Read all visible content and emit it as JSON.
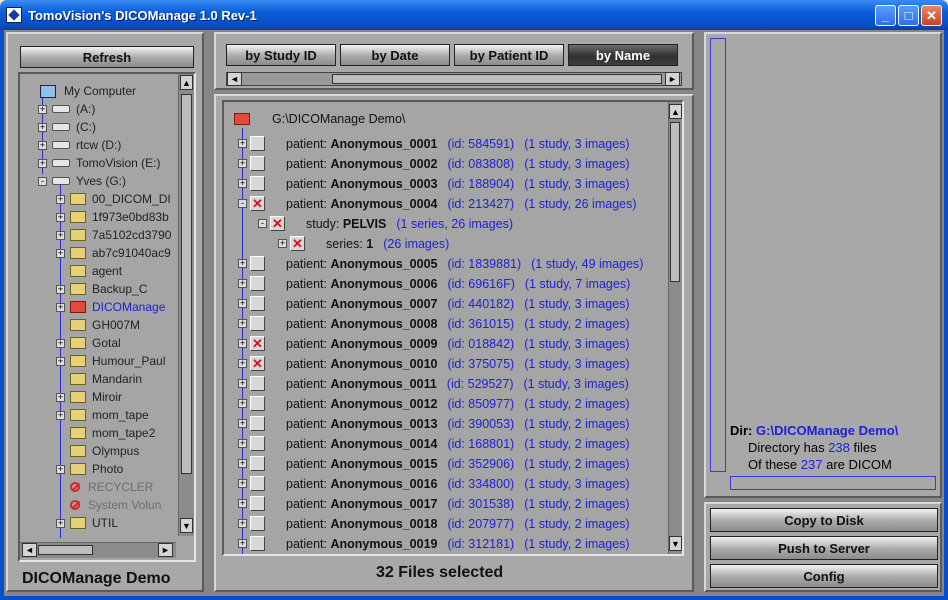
{
  "window": {
    "title": "TomoVision's  DICOManage 1.0 Rev-1",
    "controls": {
      "minimize": "_",
      "maximize": "□",
      "close": "✕"
    }
  },
  "left": {
    "refresh_label": "Refresh",
    "tree": [
      {
        "label": "My Computer",
        "icon": "computer-icon",
        "level": 0,
        "expand": ""
      },
      {
        "label": "(A:)",
        "icon": "floppy-drive-icon",
        "level": 1,
        "expand": "+"
      },
      {
        "label": "(C:)",
        "icon": "drive-icon",
        "level": 1,
        "expand": "+"
      },
      {
        "label": "rtcw (D:)",
        "icon": "cd-drive-icon",
        "level": 1,
        "expand": "+"
      },
      {
        "label": "TomoVision (E:)",
        "icon": "drive-icon",
        "level": 1,
        "expand": "+"
      },
      {
        "label": "Yves (G:)",
        "icon": "drive-icon",
        "level": 1,
        "expand": "-"
      },
      {
        "label": "00_DICOM_DI",
        "icon": "folder-icon",
        "level": 2,
        "expand": "+"
      },
      {
        "label": "1f973e0bd83b",
        "icon": "folder-icon",
        "level": 2,
        "expand": "+"
      },
      {
        "label": "7a5102cd3790",
        "icon": "folder-icon",
        "level": 2,
        "expand": "+"
      },
      {
        "label": "ab7c91040ac9",
        "icon": "folder-icon",
        "level": 2,
        "expand": "+"
      },
      {
        "label": "agent",
        "icon": "folder-icon",
        "level": 2,
        "expand": ""
      },
      {
        "label": "Backup_C",
        "icon": "folder-icon",
        "level": 2,
        "expand": "+"
      },
      {
        "label": "DICOManage",
        "icon": "open-folder-icon",
        "level": 2,
        "expand": "+",
        "selected": true
      },
      {
        "label": "GH007M",
        "icon": "folder-icon",
        "level": 2,
        "expand": ""
      },
      {
        "label": "Gotal",
        "icon": "folder-icon",
        "level": 2,
        "expand": "+"
      },
      {
        "label": "Humour_Paul",
        "icon": "folder-icon",
        "level": 2,
        "expand": "+"
      },
      {
        "label": "Mandarin",
        "icon": "folder-icon",
        "level": 2,
        "expand": ""
      },
      {
        "label": "Miroir",
        "icon": "folder-icon",
        "level": 2,
        "expand": "+"
      },
      {
        "label": "mom_tape",
        "icon": "folder-icon",
        "level": 2,
        "expand": "+"
      },
      {
        "label": "mom_tape2",
        "icon": "folder-icon",
        "level": 2,
        "expand": ""
      },
      {
        "label": "Olympus",
        "icon": "folder-icon",
        "level": 2,
        "expand": ""
      },
      {
        "label": "Photo",
        "icon": "folder-icon",
        "level": 2,
        "expand": "+"
      },
      {
        "label": "RECYCLER",
        "icon": "no-access-icon",
        "level": 2,
        "expand": "",
        "disabled": true
      },
      {
        "label": "System Volun",
        "icon": "no-access-icon",
        "level": 2,
        "expand": "",
        "disabled": true
      },
      {
        "label": "UTIL",
        "icon": "folder-icon",
        "level": 2,
        "expand": "+"
      }
    ],
    "status": "DICOManage Demo"
  },
  "middle": {
    "sort_tabs": [
      {
        "label": "by Study ID",
        "active": false
      },
      {
        "label": "by Date",
        "active": false
      },
      {
        "label": "by Patient ID",
        "active": false
      },
      {
        "label": "by Name",
        "active": true
      }
    ],
    "root_path": "G:\\DICOManage Demo\\",
    "rows": [
      {
        "kind": "patient",
        "prefix": "patient: ",
        "name": "Anonymous_0001",
        "id": "(id: 584591)",
        "info": "(1 study, 3 images)",
        "checked": false,
        "expand": "+"
      },
      {
        "kind": "patient",
        "prefix": "patient: ",
        "name": "Anonymous_0002",
        "id": "(id: 083808)",
        "info": "(1 study, 3 images)",
        "checked": false,
        "expand": "+"
      },
      {
        "kind": "patient",
        "prefix": "patient: ",
        "name": "Anonymous_0003",
        "id": "(id: 188904)",
        "info": "(1 study, 3 images)",
        "checked": false,
        "expand": "+"
      },
      {
        "kind": "patient",
        "prefix": "patient: ",
        "name": "Anonymous_0004",
        "id": "(id: 213427)",
        "info": "(1 study, 26 images)",
        "checked": true,
        "expand": "-"
      },
      {
        "kind": "study",
        "prefix": "study: ",
        "name": "PELVIS",
        "id": "",
        "info": "(1 series, 26 images)",
        "checked": true,
        "expand": "-"
      },
      {
        "kind": "series",
        "prefix": "series: ",
        "name": "1",
        "id": "",
        "info": "(26 images)",
        "checked": true,
        "expand": "+"
      },
      {
        "kind": "patient",
        "prefix": "patient: ",
        "name": "Anonymous_0005",
        "id": "(id: 1839881)",
        "info": "(1 study, 49 images)",
        "checked": false,
        "expand": "+"
      },
      {
        "kind": "patient",
        "prefix": "patient: ",
        "name": "Anonymous_0006",
        "id": "(id: 69616F)",
        "info": "(1 study, 7 images)",
        "checked": false,
        "expand": "+"
      },
      {
        "kind": "patient",
        "prefix": "patient: ",
        "name": "Anonymous_0007",
        "id": "(id: 440182)",
        "info": "(1 study, 3 images)",
        "checked": false,
        "expand": "+"
      },
      {
        "kind": "patient",
        "prefix": "patient: ",
        "name": "Anonymous_0008",
        "id": "(id: 361015)",
        "info": "(1 study, 2 images)",
        "checked": false,
        "expand": "+"
      },
      {
        "kind": "patient",
        "prefix": "patient: ",
        "name": "Anonymous_0009",
        "id": "(id: 018842)",
        "info": "(1 study, 3 images)",
        "checked": true,
        "expand": "+"
      },
      {
        "kind": "patient",
        "prefix": "patient: ",
        "name": "Anonymous_0010",
        "id": "(id: 375075)",
        "info": "(1 study, 3 images)",
        "checked": true,
        "expand": "+"
      },
      {
        "kind": "patient",
        "prefix": "patient: ",
        "name": "Anonymous_0011",
        "id": "(id: 529527)",
        "info": "(1 study, 3 images)",
        "checked": false,
        "expand": "+"
      },
      {
        "kind": "patient",
        "prefix": "patient: ",
        "name": "Anonymous_0012",
        "id": "(id: 850977)",
        "info": "(1 study, 2 images)",
        "checked": false,
        "expand": "+"
      },
      {
        "kind": "patient",
        "prefix": "patient: ",
        "name": "Anonymous_0013",
        "id": "(id: 390053)",
        "info": "(1 study, 2 images)",
        "checked": false,
        "expand": "+"
      },
      {
        "kind": "patient",
        "prefix": "patient: ",
        "name": "Anonymous_0014",
        "id": "(id: 168801)",
        "info": "(1 study, 2 images)",
        "checked": false,
        "expand": "+"
      },
      {
        "kind": "patient",
        "prefix": "patient: ",
        "name": "Anonymous_0015",
        "id": "(id: 352906)",
        "info": "(1 study, 2 images)",
        "checked": false,
        "expand": "+"
      },
      {
        "kind": "patient",
        "prefix": "patient: ",
        "name": "Anonymous_0016",
        "id": "(id: 334800)",
        "info": "(1 study, 3 images)",
        "checked": false,
        "expand": "+"
      },
      {
        "kind": "patient",
        "prefix": "patient: ",
        "name": "Anonymous_0017",
        "id": "(id: 301538)",
        "info": "(1 study, 2 images)",
        "checked": false,
        "expand": "+"
      },
      {
        "kind": "patient",
        "prefix": "patient: ",
        "name": "Anonymous_0018",
        "id": "(id: 207977)",
        "info": "(1 study, 2 images)",
        "checked": false,
        "expand": "+"
      },
      {
        "kind": "patient",
        "prefix": "patient: ",
        "name": "Anonymous_0019",
        "id": "(id: 312181)",
        "info": "(1 study, 2 images)",
        "checked": false,
        "expand": "+"
      }
    ],
    "status": "32 Files selected"
  },
  "right": {
    "dir_label": "Dir:",
    "dir_path": "G:\\DICOManage Demo\\",
    "has_prefix": "Directory has",
    "file_count": "238",
    "has_suffix": "files",
    "dicom_prefix": "Of these",
    "dicom_count": "237",
    "dicom_suffix": "are DICOM",
    "buttons": {
      "copy": "Copy to Disk",
      "push": "Push to Server",
      "config": "Config"
    }
  },
  "colors": {
    "accent_blue": "#2020d8",
    "check_red": "#d0121b",
    "titlebar": "#0a5fd8"
  }
}
